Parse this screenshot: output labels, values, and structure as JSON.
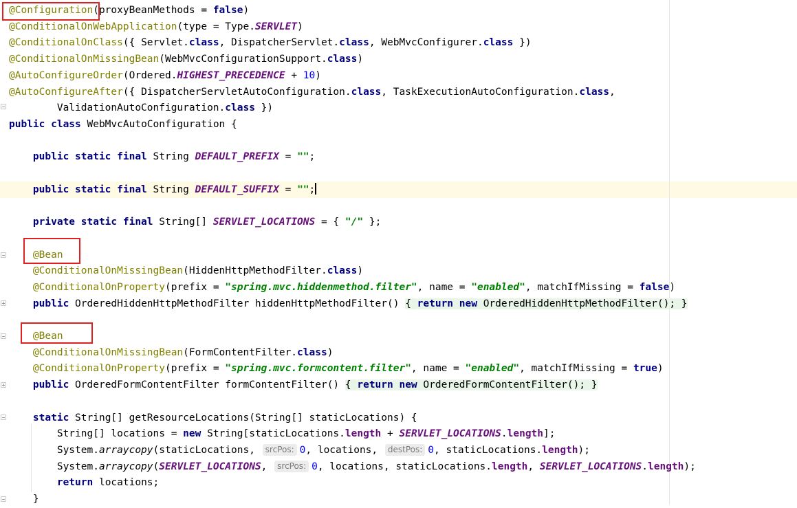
{
  "editor": {
    "lines": [
      {
        "segments": [
          {
            "t": "@Configuration",
            "c": "ann"
          },
          {
            "t": "(proxyBeanMethods = "
          },
          {
            "t": "false",
            "c": "kw"
          },
          {
            "t": ")"
          }
        ]
      },
      {
        "segments": [
          {
            "t": "@ConditionalOnWebApplication",
            "c": "ann"
          },
          {
            "t": "(type = Type."
          },
          {
            "t": "SERVLET",
            "c": "sf"
          },
          {
            "t": ")"
          }
        ]
      },
      {
        "segments": [
          {
            "t": "@ConditionalOnClass",
            "c": "ann"
          },
          {
            "t": "({ Servlet."
          },
          {
            "t": "class",
            "c": "kw"
          },
          {
            "t": ", DispatcherServlet."
          },
          {
            "t": "class",
            "c": "kw"
          },
          {
            "t": ", WebMvcConfigurer."
          },
          {
            "t": "class",
            "c": "kw"
          },
          {
            "t": " })"
          }
        ]
      },
      {
        "segments": [
          {
            "t": "@ConditionalOnMissingBean",
            "c": "ann"
          },
          {
            "t": "(WebMvcConfigurationSupport."
          },
          {
            "t": "class",
            "c": "kw"
          },
          {
            "t": ")"
          }
        ]
      },
      {
        "segments": [
          {
            "t": "@AutoConfigureOrder",
            "c": "ann"
          },
          {
            "t": "(Ordered."
          },
          {
            "t": "HIGHEST_PRECEDENCE",
            "c": "sf"
          },
          {
            "t": " + "
          },
          {
            "t": "10",
            "c": "num"
          },
          {
            "t": ")"
          }
        ]
      },
      {
        "segments": [
          {
            "t": "@AutoConfigureAfter",
            "c": "ann"
          },
          {
            "t": "({ DispatcherServletAutoConfiguration."
          },
          {
            "t": "class",
            "c": "kw"
          },
          {
            "t": ", TaskExecutionAutoConfiguration."
          },
          {
            "t": "class",
            "c": "kw"
          },
          {
            "t": ","
          }
        ]
      },
      {
        "segments": [
          {
            "t": "        ValidationAutoConfiguration."
          },
          {
            "t": "class",
            "c": "kw"
          },
          {
            "t": " })"
          }
        ]
      },
      {
        "segments": [
          {
            "t": "public class",
            "c": "kw"
          },
          {
            "t": " WebMvcAutoConfiguration {"
          }
        ]
      },
      {
        "segments": []
      },
      {
        "segments": [
          {
            "t": "    "
          },
          {
            "t": "public static final",
            "c": "kw"
          },
          {
            "t": " String "
          },
          {
            "t": "DEFAULT_PREFIX",
            "c": "sf"
          },
          {
            "t": " = "
          },
          {
            "t": "\"\"",
            "c": "str"
          },
          {
            "t": ";"
          }
        ]
      },
      {
        "segments": []
      },
      {
        "segments": [
          {
            "t": "    "
          },
          {
            "t": "public static final",
            "c": "kw"
          },
          {
            "t": " String "
          },
          {
            "t": "DEFAULT_SUFFIX",
            "c": "sf"
          },
          {
            "t": " = "
          },
          {
            "t": "\"\"",
            "c": "str"
          },
          {
            "t": ";"
          },
          {
            "t": "",
            "c": "caret"
          }
        ]
      },
      {
        "segments": []
      },
      {
        "segments": [
          {
            "t": "    "
          },
          {
            "t": "private static final",
            "c": "kw"
          },
          {
            "t": " String[] "
          },
          {
            "t": "SERVLET_LOCATIONS",
            "c": "sf"
          },
          {
            "t": " = { "
          },
          {
            "t": "\"/\"",
            "c": "str"
          },
          {
            "t": " };"
          }
        ]
      },
      {
        "segments": []
      },
      {
        "segments": [
          {
            "t": "    "
          },
          {
            "t": "@Bean",
            "c": "ann"
          }
        ]
      },
      {
        "segments": [
          {
            "t": "    "
          },
          {
            "t": "@ConditionalOnMissingBean",
            "c": "ann"
          },
          {
            "t": "(HiddenHttpMethodFilter."
          },
          {
            "t": "class",
            "c": "kw"
          },
          {
            "t": ")"
          }
        ]
      },
      {
        "segments": [
          {
            "t": "    "
          },
          {
            "t": "@ConditionalOnProperty",
            "c": "ann"
          },
          {
            "t": "(prefix = "
          },
          {
            "t": "\"spring.mvc.hiddenmethod.filter\"",
            "c": "str"
          },
          {
            "t": ", name = "
          },
          {
            "t": "\"enabled\"",
            "c": "str"
          },
          {
            "t": ", matchIfMissing = "
          },
          {
            "t": "false",
            "c": "kw"
          },
          {
            "t": ")"
          }
        ]
      },
      {
        "segments": [
          {
            "t": "    "
          },
          {
            "t": "public",
            "c": "kw"
          },
          {
            "t": " OrderedHiddenHttpMethodFilter hiddenHttpMethodFilter() "
          },
          {
            "t": "{ ",
            "c": "fold"
          },
          {
            "t": "return new",
            "c": "kwfold"
          },
          {
            "t": " OrderedHiddenHttpMethodFilter(); }",
            "c": "fold"
          }
        ]
      },
      {
        "segments": []
      },
      {
        "segments": [
          {
            "t": "    "
          },
          {
            "t": "@Bean",
            "c": "ann"
          }
        ]
      },
      {
        "segments": [
          {
            "t": "    "
          },
          {
            "t": "@ConditionalOnMissingBean",
            "c": "ann"
          },
          {
            "t": "(FormContentFilter."
          },
          {
            "t": "class",
            "c": "kw"
          },
          {
            "t": ")"
          }
        ]
      },
      {
        "segments": [
          {
            "t": "    "
          },
          {
            "t": "@ConditionalOnProperty",
            "c": "ann"
          },
          {
            "t": "(prefix = "
          },
          {
            "t": "\"spring.mvc.formcontent.filter\"",
            "c": "str"
          },
          {
            "t": ", name = "
          },
          {
            "t": "\"enabled\"",
            "c": "str"
          },
          {
            "t": ", matchIfMissing = "
          },
          {
            "t": "true",
            "c": "kw"
          },
          {
            "t": ")"
          }
        ]
      },
      {
        "segments": [
          {
            "t": "    "
          },
          {
            "t": "public",
            "c": "kw"
          },
          {
            "t": " OrderedFormContentFilter formContentFilter() "
          },
          {
            "t": "{ ",
            "c": "fold"
          },
          {
            "t": "return new",
            "c": "kwfold"
          },
          {
            "t": " OrderedFormContentFilter(); }",
            "c": "fold"
          }
        ]
      },
      {
        "segments": []
      },
      {
        "segments": [
          {
            "t": "    "
          },
          {
            "t": "static",
            "c": "kw"
          },
          {
            "t": " String[] getResourceLocations(String[] staticLocations) {"
          }
        ]
      },
      {
        "segments": [
          {
            "t": "        String[] locations = "
          },
          {
            "t": "new",
            "c": "kw"
          },
          {
            "t": " String[staticLocations."
          },
          {
            "t": "length",
            "c": "fld"
          },
          {
            "t": " + "
          },
          {
            "t": "SERVLET_LOCATIONS",
            "c": "sf"
          },
          {
            "t": "."
          },
          {
            "t": "length",
            "c": "fld"
          },
          {
            "t": "];"
          }
        ]
      },
      {
        "segments": [
          {
            "t": "        System."
          },
          {
            "t": "arraycopy",
            "c": "mth"
          },
          {
            "t": "(staticLocations, "
          },
          {
            "t": "srcPos:",
            "c": "hint"
          },
          {
            "t": "0",
            "c": "num"
          },
          {
            "t": ", locations, "
          },
          {
            "t": "destPos:",
            "c": "hint"
          },
          {
            "t": "0",
            "c": "num"
          },
          {
            "t": ", staticLocations."
          },
          {
            "t": "length",
            "c": "fld"
          },
          {
            "t": ");"
          }
        ]
      },
      {
        "segments": [
          {
            "t": "        System."
          },
          {
            "t": "arraycopy",
            "c": "mth"
          },
          {
            "t": "("
          },
          {
            "t": "SERVLET_LOCATIONS",
            "c": "sf"
          },
          {
            "t": ", "
          },
          {
            "t": "srcPos:",
            "c": "hint"
          },
          {
            "t": "0",
            "c": "num"
          },
          {
            "t": ", locations, staticLocations."
          },
          {
            "t": "length",
            "c": "fld"
          },
          {
            "t": ", "
          },
          {
            "t": "SERVLET_LOCATIONS",
            "c": "sf"
          },
          {
            "t": "."
          },
          {
            "t": "length",
            "c": "fld"
          },
          {
            "t": ");"
          }
        ]
      },
      {
        "segments": [
          {
            "t": "        "
          },
          {
            "t": "return",
            "c": "kw"
          },
          {
            "t": " locations;"
          }
        ]
      },
      {
        "segments": [
          {
            "t": "    }"
          }
        ]
      }
    ]
  }
}
